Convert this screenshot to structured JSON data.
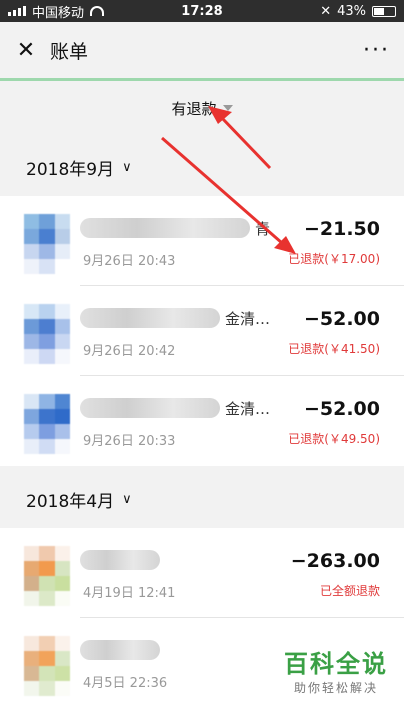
{
  "status_bar": {
    "carrier": "中国移动",
    "time": "17:28",
    "battery": "43%"
  },
  "header": {
    "title": "账单",
    "close_icon": "close-icon",
    "more_icon": "more-icon"
  },
  "filter": {
    "label": "有退款"
  },
  "sections": [
    {
      "month": "2018年9月",
      "items": [
        {
          "name_tail": "青",
          "date": "9月26日 20:43",
          "amount": "−21.50",
          "refund": "已退款(￥17.00)"
        },
        {
          "name_tail": "金清…",
          "date": "9月26日 20:42",
          "amount": "−52.00",
          "refund": "已退款(￥41.50)"
        },
        {
          "name_tail": "金清…",
          "date": "9月26日 20:33",
          "amount": "−52.00",
          "refund": "已退款(￥49.50)"
        }
      ]
    },
    {
      "month": "2018年4月",
      "items": [
        {
          "name_tail": "",
          "date": "4月19日 12:41",
          "amount": "−263.00",
          "refund": "已全额退款"
        },
        {
          "name_tail": "",
          "date": "4月5日 22:36",
          "amount": "",
          "refund": ""
        }
      ]
    }
  ],
  "watermark": {
    "title": "百科全说",
    "subtitle": "助你轻松解决"
  },
  "colors": {
    "refund": "#e03a3a",
    "accent_line": "#9ed8ad",
    "arrow": "#e8322f"
  }
}
